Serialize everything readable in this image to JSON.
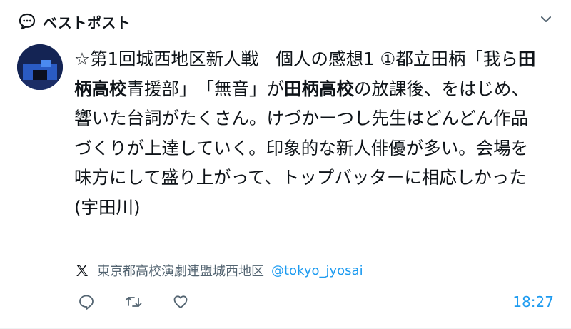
{
  "header": {
    "title": "ベストポスト",
    "icon": "speech-bubble-icon",
    "menu_icon": "chevron-down-icon"
  },
  "tweet": {
    "segments": [
      {
        "text": "☆第1回城西地区新人戦　個人の感想1 ①都立田柄「我ら",
        "bold": false
      },
      {
        "text": "田柄高校",
        "bold": true
      },
      {
        "text": "青援部」　「無音」が",
        "bold": false
      },
      {
        "text": "田柄高校",
        "bold": true
      },
      {
        "text": "の放課後、をはじめ、響いた台詞がたくさん。けづかーつし先生はどんどん作品づくりが上達していく。印象的な新人俳優が多い。会場を味方にして盛り上がって、トップバッターに相応しかった(宇田川)",
        "bold": false
      }
    ]
  },
  "source": {
    "platform_icon": "x-logo-icon",
    "name": "東京都高校演劇連盟城西地区",
    "handle": "@tokyo_jyosai"
  },
  "actions": {
    "icons": [
      "reply-icon",
      "retweet-icon",
      "like-icon"
    ]
  },
  "timestamp": "18:27",
  "colors": {
    "accent": "#1d9bf0",
    "text": "#0f1419",
    "muted": "#536471"
  }
}
